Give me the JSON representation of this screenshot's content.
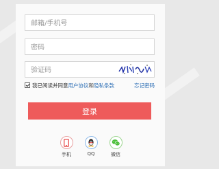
{
  "form": {
    "email_placeholder": "邮箱/手机号",
    "password_placeholder": "密码",
    "captcha_placeholder": "验证码"
  },
  "agree": {
    "prefix": "我已阅读并同意",
    "user_agreement": "用户协议",
    "and": "和",
    "privacy": "隐私条款",
    "forgot": "忘记密码"
  },
  "login_label": "登录",
  "social": [
    {
      "label": "手机",
      "icon": "phone-icon",
      "color": "#e84c4c"
    },
    {
      "label": "QQ",
      "icon": "qq-icon",
      "color": "#222222"
    },
    {
      "label": "微信",
      "icon": "wechat-icon",
      "color": "#4cbf3a"
    }
  ],
  "colors": {
    "accent": "#ee5b5b",
    "link": "#2d6fb5"
  }
}
